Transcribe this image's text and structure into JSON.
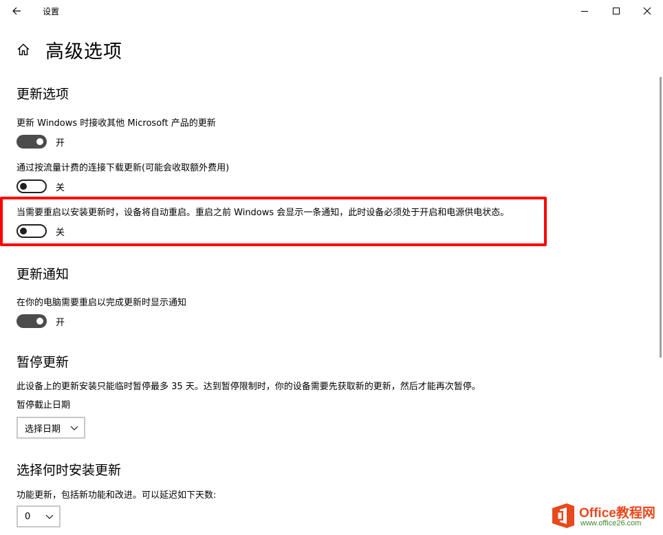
{
  "titlebar": {
    "title": "设置"
  },
  "page": {
    "title": "高级选项"
  },
  "update_options": {
    "heading": "更新选项",
    "items": [
      {
        "label": "更新 Windows 时接收其他 Microsoft 产品的更新",
        "state": "开"
      },
      {
        "label": "通过按流量计费的连接下载更新(可能会收取额外费用)",
        "state": "关"
      },
      {
        "label": "当需要重启以安装更新时，设备将自动重启。重启之前 Windows 会显示一条通知，此时设备必须处于开启和电源供电状态。",
        "state": "关"
      }
    ]
  },
  "update_notifications": {
    "heading": "更新通知",
    "items": [
      {
        "label": "在你的电脑需要重启以完成更新时显示通知",
        "state": "开"
      }
    ]
  },
  "pause_updates": {
    "heading": "暂停更新",
    "description": "此设备上的更新安装只能临时暂停最多 35 天。达到暂停限制时，你的设备需要先获取新的更新，然后才能再次暂停。",
    "date_label": "暂停截止日期",
    "date_select": "选择日期"
  },
  "install_time": {
    "heading": "选择何时安装更新",
    "feature_label": "功能更新，包括新功能和改进。可以延迟如下天数:",
    "feature_select": "0"
  },
  "watermark": {
    "brand": "Office教程网",
    "url": "www.office26.com"
  },
  "colors": {
    "toggle_on": "#4c4c4c",
    "highlight": "#ff0000",
    "watermark_orange": "#e8491d",
    "watermark_green": "#3a8a2a"
  }
}
